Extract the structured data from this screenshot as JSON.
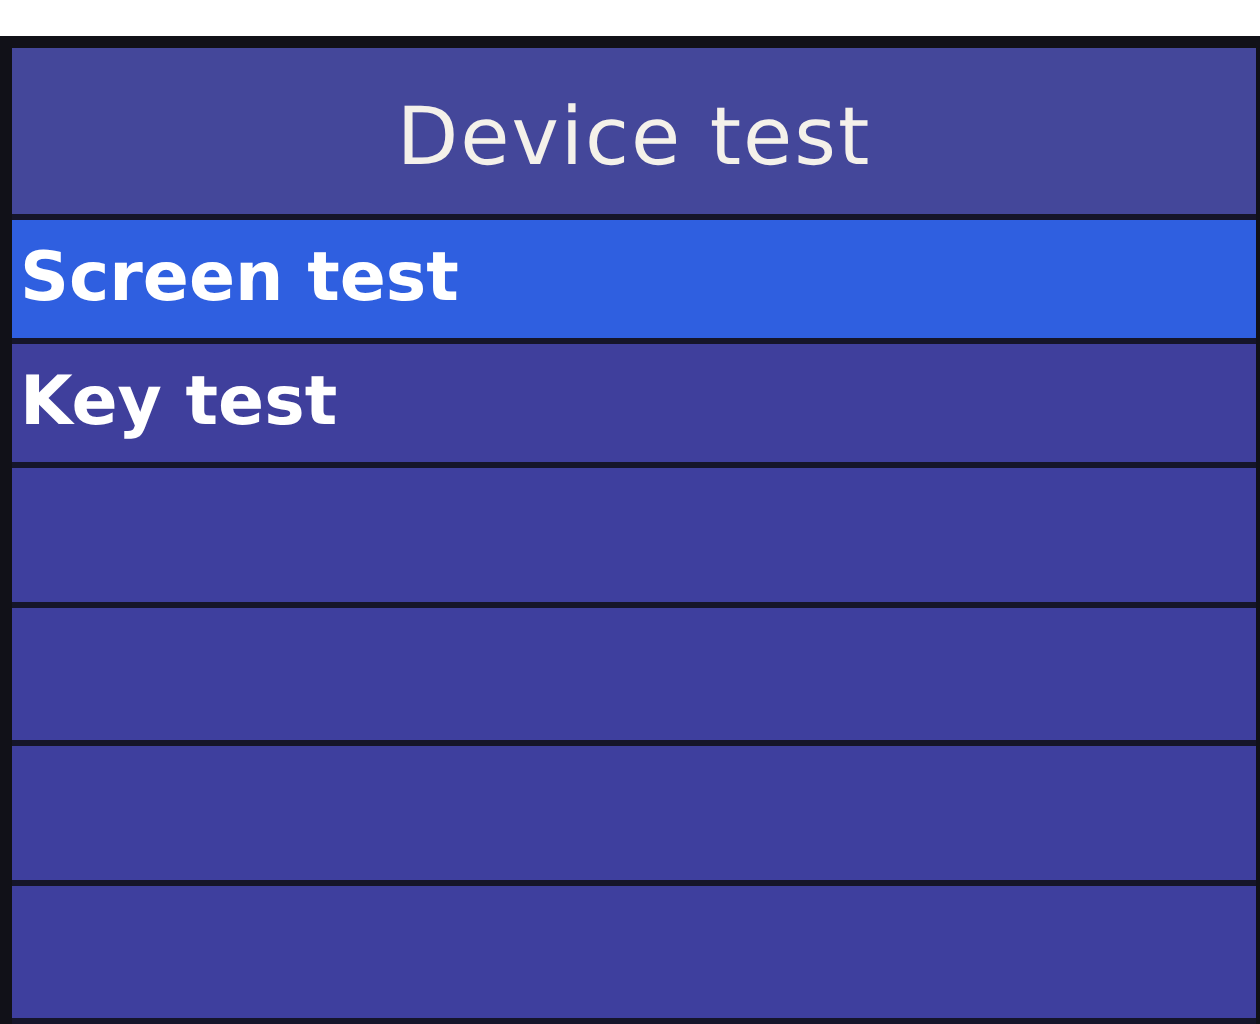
{
  "header": {
    "title": "Device test"
  },
  "menu": [
    {
      "label": "Screen test",
      "selected": true
    },
    {
      "label": "Key test",
      "selected": false
    }
  ]
}
